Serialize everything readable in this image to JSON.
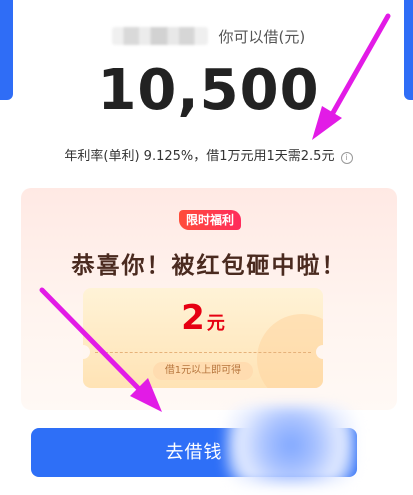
{
  "header": {
    "can_borrow_label": "你可以借(元)",
    "amount": "10,500",
    "rate_text": "年利率(单利) 9.125%，借1万元用1天需2.5元"
  },
  "promo": {
    "badge": "限时福利",
    "title": "恭喜你！被红包砸中啦！",
    "coupon": {
      "amount": "2",
      "unit": "元",
      "condition": "借1元以上即可得"
    }
  },
  "cta": {
    "label": "去借钱"
  },
  "colors": {
    "brand_blue": "#2e6ff7",
    "arrow_magenta": "#e21be6",
    "coupon_red": "#e60012"
  },
  "icons": {
    "info": "info-circle-icon"
  }
}
